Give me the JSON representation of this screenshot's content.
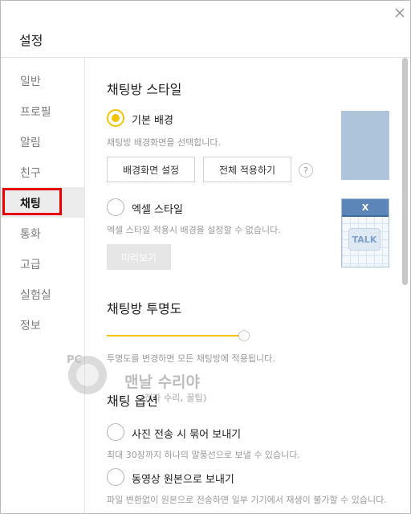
{
  "window": {
    "title": "설정",
    "close_symbol": "×"
  },
  "sidebar": {
    "items": [
      {
        "label": "일반"
      },
      {
        "label": "프로필"
      },
      {
        "label": "알림"
      },
      {
        "label": "친구"
      },
      {
        "label": "채팅",
        "active": true
      },
      {
        "label": "통화"
      },
      {
        "label": "고급"
      },
      {
        "label": "실험실"
      },
      {
        "label": "정보"
      }
    ]
  },
  "chat_style": {
    "heading": "채팅방 스타일",
    "basic": {
      "label": "기본 배경",
      "selected": true,
      "description": "채팅방 배경화면을 선택합니다.",
      "set_wallpaper_button": "배경화면 설정",
      "apply_all_button": "전체 적용하기",
      "help_symbol": "?"
    },
    "excel": {
      "label": "엑셀 스타일",
      "selected": false,
      "description": "엑셀 스타일 적용시 배경을 설정할 수 없습니다.",
      "preview_button": "미리보기",
      "preview_icon_letter": "X",
      "preview_bubble_text": "TALK"
    }
  },
  "transparency": {
    "heading": "채팅방 투명도",
    "level": 1.0,
    "description": "투명도를 변경하면 모든 채팅방에 적용됩니다."
  },
  "chat_options": {
    "heading": "채팅 옵션",
    "photo": {
      "label": "사진 전송 시 묶어 보내기",
      "selected": false,
      "description": "최대 30장까지 하나의 말풍선으로 보낼 수 있습니다."
    },
    "video": {
      "label": "동영상 원본으로 보내기",
      "selected": false,
      "description": "파일 변환없이 원본으로 전송하면 일부 기기에서 재생이 불가할 수 있습니다."
    }
  },
  "watermark": {
    "line1": "맨날 수리야",
    "line2": "(전자 수리, 꿀팁)",
    "badge": "PC"
  },
  "colors": {
    "accent_yellow": "#f5c400",
    "highlight_red": "#e60000",
    "preview_blue": "#aec4db"
  }
}
